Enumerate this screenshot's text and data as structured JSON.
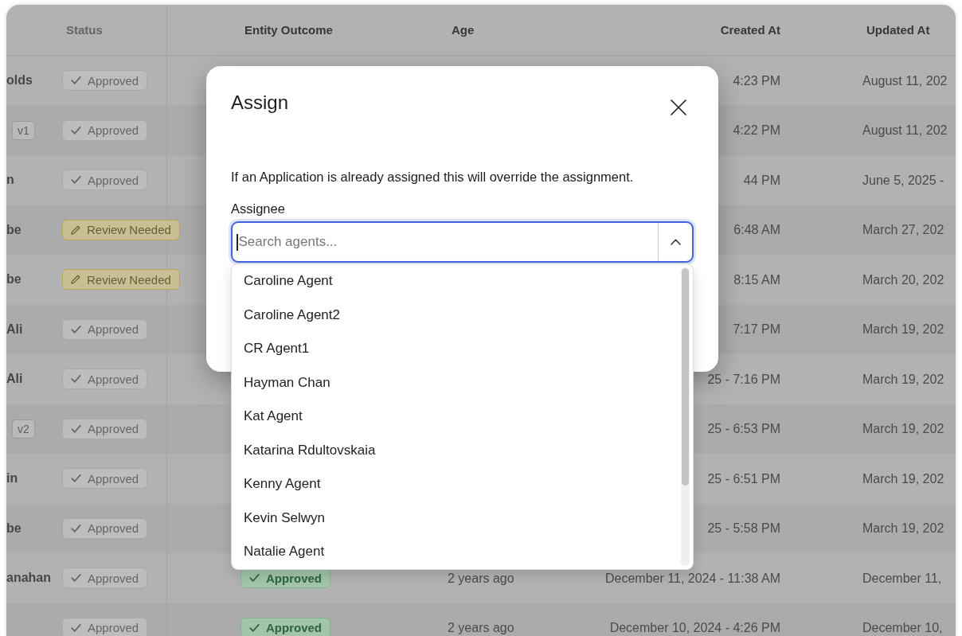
{
  "table": {
    "columns": [
      {
        "label": "Status"
      },
      {
        "label": "Entity Outcome"
      },
      {
        "label": "Age"
      },
      {
        "label": "Created At"
      },
      {
        "label": "Updated At"
      }
    ],
    "rows": [
      {
        "column_1": "olds",
        "status": {
          "label": "Approved",
          "kind": "approved"
        },
        "created_at": "4:23 PM",
        "updated_at": "August 11, 202"
      },
      {
        "tag": "v1",
        "status": {
          "label": "Approved",
          "kind": "approved"
        },
        "created_at": "4:22 PM",
        "updated_at": "August 11, 202"
      },
      {
        "column_1": "n",
        "status": {
          "label": "Approved",
          "kind": "approved"
        },
        "created_at": "44 PM",
        "updated_at": "June 5, 2025 -"
      },
      {
        "column_1": "be",
        "status": {
          "label": "Review Needed",
          "kind": "review"
        },
        "created_at": "6:48 AM",
        "updated_at": "March 27, 202"
      },
      {
        "column_1": "be",
        "status": {
          "label": "Review Needed",
          "kind": "review"
        },
        "created_at": "8:15 AM",
        "updated_at": "March 20, 202"
      },
      {
        "column_1": "Ali",
        "status": {
          "label": "Approved",
          "kind": "approved"
        },
        "created_at": "7:17 PM",
        "updated_at": "March 19, 202"
      },
      {
        "column_1": "Ali",
        "status": {
          "label": "Approved",
          "kind": "approved"
        },
        "created_at": "25 - 7:16 PM",
        "updated_at": "March 19, 202"
      },
      {
        "tag": "v2",
        "status": {
          "label": "Approved",
          "kind": "approved"
        },
        "created_at": "25 - 6:53 PM",
        "updated_at": "March 19, 202"
      },
      {
        "column_1": "in",
        "status": {
          "label": "Approved",
          "kind": "approved"
        },
        "created_at": "25 - 6:51 PM",
        "updated_at": "March 19, 202"
      },
      {
        "column_1": "be",
        "status": {
          "label": "Approved",
          "kind": "approved"
        },
        "created_at": "25 - 5:58 PM",
        "updated_at": "March 19, 202"
      },
      {
        "column_1": "anahan",
        "status": {
          "label": "Approved",
          "kind": "approved"
        },
        "entity_outcome": {
          "label": "Approved",
          "kind": "approved"
        },
        "age": "2 years ago",
        "created_at": "December 11, 2024 - 11:38 AM",
        "updated_at": "December 11,"
      },
      {
        "status": {
          "label": "Approved",
          "kind": "approved"
        },
        "entity_outcome": {
          "label": "Approved",
          "kind": "approved"
        },
        "age": "2 years ago",
        "created_at": "December 10, 2024 - 4:26 PM",
        "updated_at": "December 10,"
      }
    ]
  },
  "dialog": {
    "title": "Assign",
    "description": "If an Application is already assigned this will override the assignment.",
    "field_label": "Assignee",
    "search": {
      "placeholder": "Search agents...",
      "expanded": true
    },
    "options": [
      {
        "label": "Caroline Agent",
        "selected": false
      },
      {
        "label": "Caroline Agent2",
        "selected": false
      },
      {
        "label": "CR Agent1",
        "selected": false
      },
      {
        "label": "Hayman Chan",
        "selected": false
      },
      {
        "label": "Kat Agent",
        "selected": false
      },
      {
        "label": "Katarina Rdultovskaia",
        "selected": false
      },
      {
        "label": "Kenny Agent",
        "selected": false
      },
      {
        "label": "Kevin Selwyn",
        "selected": false
      },
      {
        "label": "Natalie Agent",
        "selected": false
      }
    ]
  }
}
